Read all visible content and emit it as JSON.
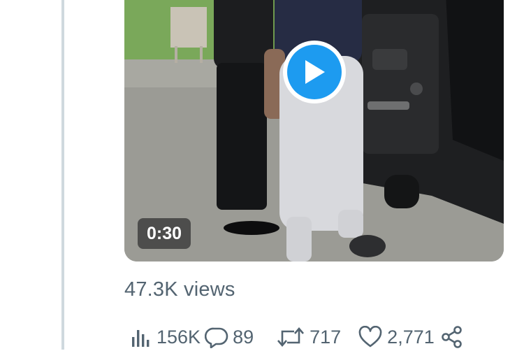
{
  "video": {
    "duration": "0:30",
    "play_icon": "play-icon",
    "accent_color": "#1d9bf0"
  },
  "tweet": {
    "views_text": "47.3K views"
  },
  "actions": {
    "analytics": {
      "icon": "bar-chart-icon",
      "count": "156K"
    },
    "reply": {
      "icon": "speech-bubble-icon",
      "count": "89"
    },
    "retweet": {
      "icon": "retweet-icon",
      "count": "717"
    },
    "like": {
      "icon": "heart-icon",
      "count": "2,771"
    },
    "share": {
      "icon": "share-icon"
    }
  }
}
